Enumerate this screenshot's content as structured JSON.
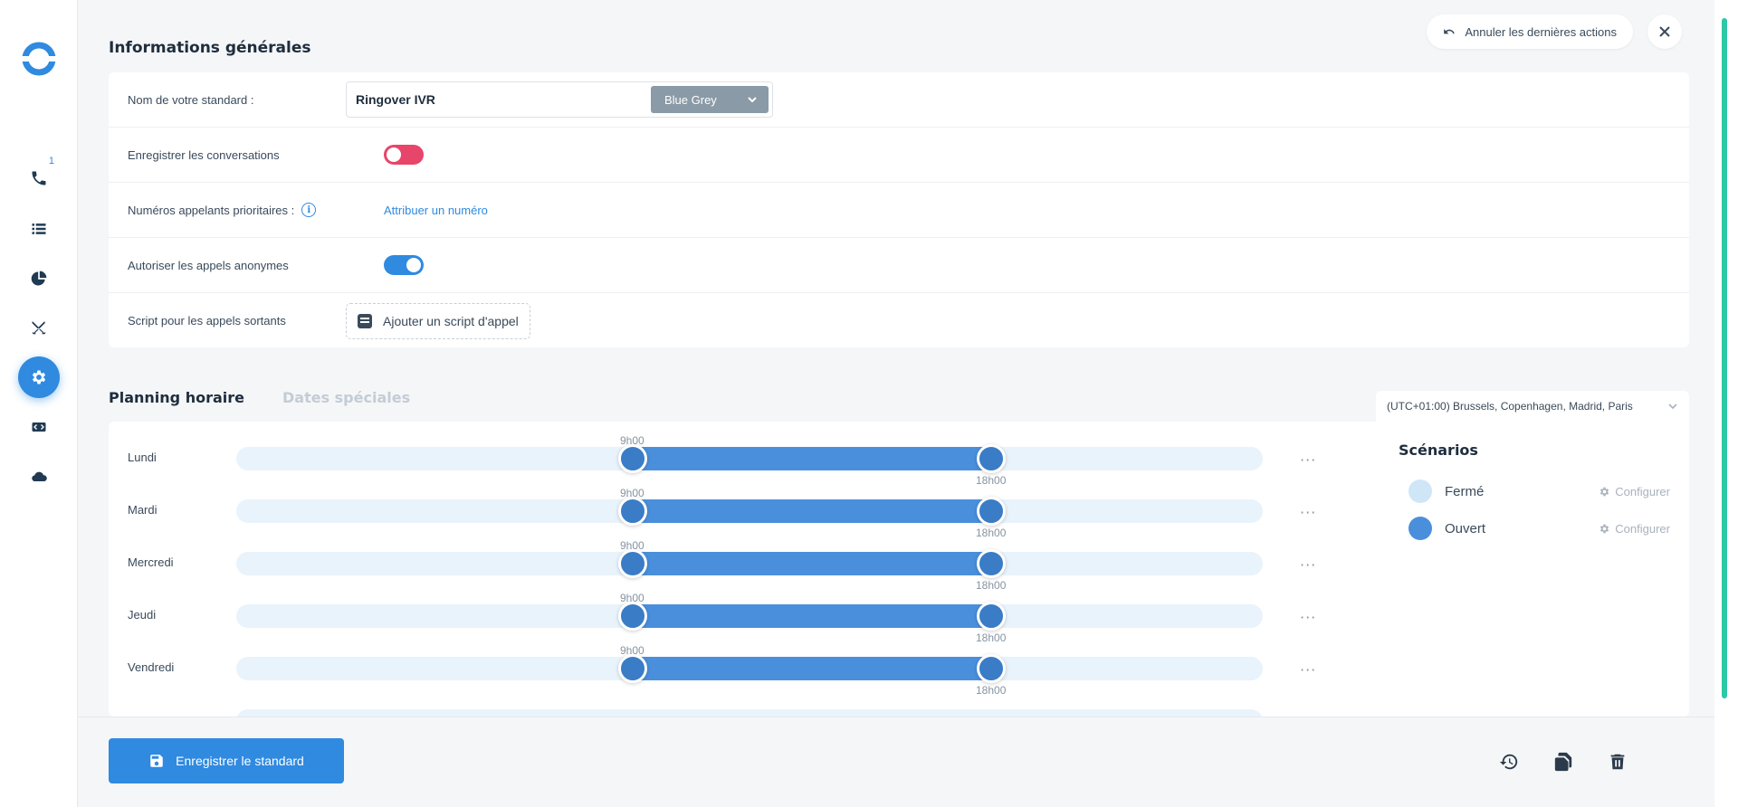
{
  "sidebar": {
    "logo": "ringover-logo",
    "items": [
      {
        "icon": "phone-icon",
        "badge": "1"
      },
      {
        "icon": "list-icon"
      },
      {
        "icon": "pie-chart-icon"
      },
      {
        "icon": "swords-icon"
      },
      {
        "icon": "gear-icon",
        "active": true
      },
      {
        "icon": "code-icon"
      },
      {
        "icon": "cloud-icon"
      }
    ]
  },
  "header": {
    "undo_label": "Annuler les dernières actions"
  },
  "general": {
    "title": "Informations générales",
    "name_label": "Nom de votre standard :",
    "name_value": "Ringover IVR",
    "color_value": "Blue Grey",
    "record_label": "Enregistrer les conversations",
    "record_enabled": false,
    "priority_label": "Numéros appelants prioritaires :",
    "priority_link": "Attribuer un numéro",
    "anon_label": "Autoriser les appels anonymes",
    "anon_enabled": true,
    "script_label": "Script pour les appels sortants",
    "script_button": "Ajouter un script d'appel"
  },
  "planning": {
    "tabs": [
      "Planning horaire",
      "Dates spéciales"
    ],
    "timezone": "(UTC+01:00) Brussels, Copenhagen, Madrid, Paris",
    "days": [
      {
        "label": "Lundi",
        "start": "9h00",
        "end": "18h00"
      },
      {
        "label": "Mardi",
        "start": "9h00",
        "end": "18h00"
      },
      {
        "label": "Mercredi",
        "start": "9h00",
        "end": "18h00"
      },
      {
        "label": "Jeudi",
        "start": "9h00",
        "end": "18h00"
      },
      {
        "label": "Vendredi",
        "start": "9h00",
        "end": "18h00"
      }
    ],
    "more": "···",
    "scenarios_title": "Scénarios",
    "scenarios": [
      {
        "name": "Fermé",
        "config": "Configurer",
        "color": "#cfe6f7"
      },
      {
        "name": "Ouvert",
        "config": "Configurer",
        "color": "#4a8fdc"
      }
    ]
  },
  "footer": {
    "save_label": "Enregistrer le standard"
  },
  "colors": {
    "accent": "#2f8ae0",
    "toggle_off": "#e8456b",
    "range": "#4a8fdc",
    "scrollbar": "#2dc8a8"
  }
}
